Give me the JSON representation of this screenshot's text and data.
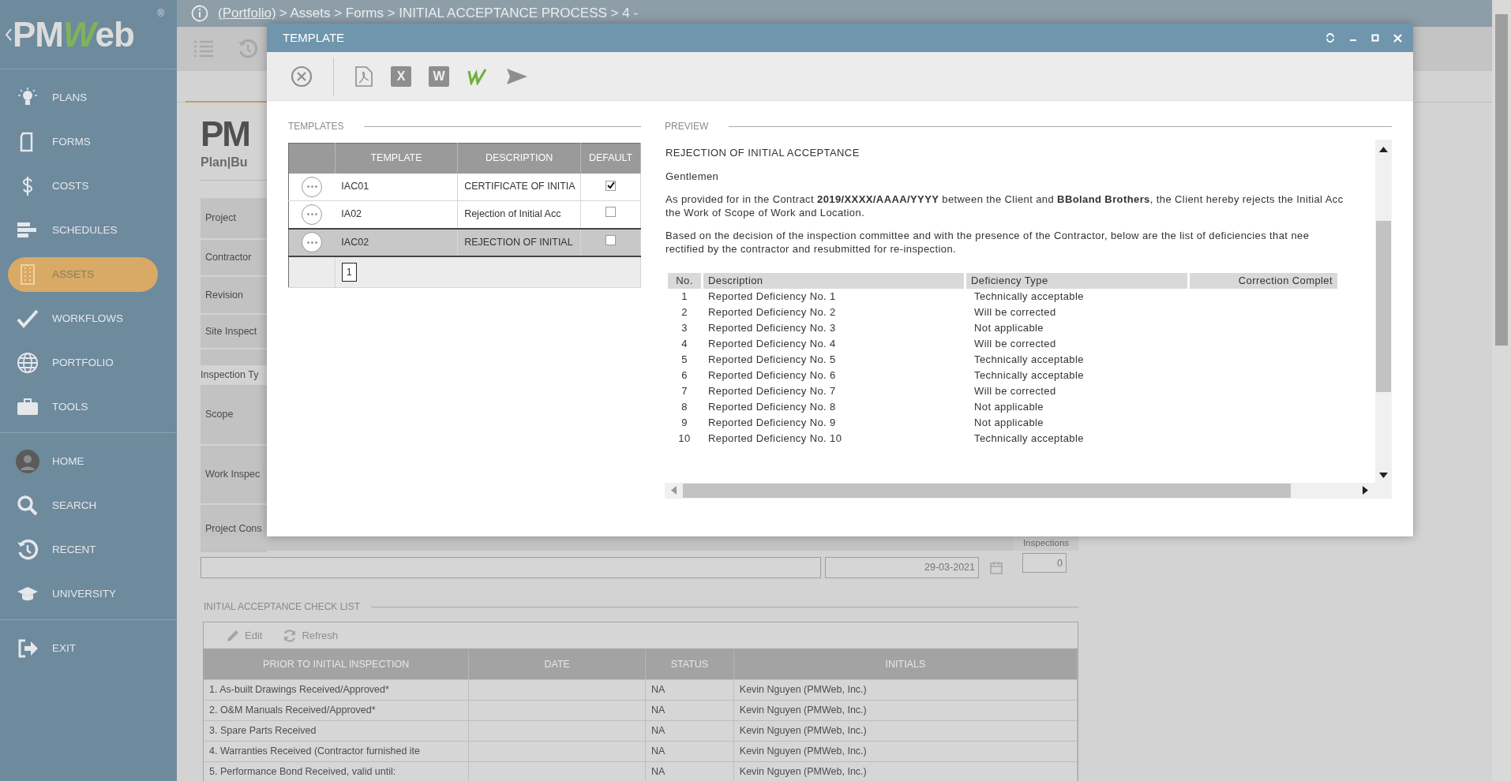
{
  "sidebar": {
    "logo": "PMWeb",
    "registered": "®",
    "sections": [
      {
        "items": [
          {
            "label": "PLANS",
            "selected": false
          },
          {
            "label": "FORMS",
            "selected": false
          },
          {
            "label": "COSTS",
            "selected": false
          },
          {
            "label": "SCHEDULES",
            "selected": false
          },
          {
            "label": "ASSETS",
            "selected": true
          },
          {
            "label": "WORKFLOWS",
            "selected": false
          },
          {
            "label": "PORTFOLIO",
            "selected": false
          },
          {
            "label": "TOOLS",
            "selected": false
          }
        ]
      },
      {
        "items": [
          {
            "label": "HOME",
            "selected": false
          },
          {
            "label": "SEARCH",
            "selected": false
          },
          {
            "label": "RECENT",
            "selected": false
          },
          {
            "label": "UNIVERSITY",
            "selected": false
          }
        ]
      },
      {
        "items": [
          {
            "label": "EXIT",
            "selected": false
          }
        ]
      }
    ]
  },
  "breadcrumb": {
    "link": "(Portfolio)",
    "path": "> Assets > Forms > INITIAL ACCEPTANCE PROCESS > 4 -"
  },
  "form": {
    "logo": "PM",
    "tagline": "Plan|Bu",
    "fields": [
      {
        "kind": "label",
        "label": "Project"
      },
      {
        "kind": "label",
        "label": "Contractor"
      },
      {
        "kind": "label",
        "label": "Revision"
      },
      {
        "kind": "label",
        "label": "Site Inspect"
      },
      {
        "kind": "spacer"
      },
      {
        "kind": "heading",
        "label": "Inspection Ty"
      },
      {
        "kind": "label",
        "label": "Scope"
      },
      {
        "kind": "label",
        "label": "Work Inspec"
      },
      {
        "kind": "label",
        "label": "Project Cons"
      }
    ],
    "inspections_label": "Inspections",
    "date": "29-03-2021",
    "count": "0"
  },
  "checklist": {
    "heading": "INITIAL ACCEPTANCE CHECK LIST",
    "tools": [
      {
        "kind": "edit",
        "label": "Edit"
      },
      {
        "kind": "refresh",
        "label": "Refresh"
      }
    ],
    "columns": [
      "PRIOR TO INITIAL INSPECTION",
      "DATE",
      "STATUS",
      "INITIALS"
    ],
    "rows": [
      {
        "item": "1. As-built Drawings Received/Approved*",
        "status": "NA",
        "initials": "Kevin Nguyen (PMWeb, Inc.)"
      },
      {
        "item": "2. O&M Manuals Received/Approved*",
        "status": "NA",
        "initials": "Kevin Nguyen (PMWeb, Inc.)"
      },
      {
        "item": "3. Spare Parts Received",
        "status": "NA",
        "initials": "Kevin Nguyen (PMWeb, Inc.)"
      },
      {
        "item": "4. Warranties Received (Contractor furnished ite",
        "status": "NA",
        "initials": "Kevin Nguyen (PMWeb, Inc.)"
      },
      {
        "item": "5. Performance Bond Received, valid until:",
        "status": "NA",
        "initials": "Kevin Nguyen (PMWeb, Inc.)"
      }
    ]
  },
  "modal": {
    "title": "TEMPLATE",
    "toolbar": [
      {
        "kind": "close"
      },
      {
        "kind": "pdf"
      },
      {
        "kind": "excel",
        "label": "X"
      },
      {
        "kind": "word",
        "label": "W"
      },
      {
        "kind": "zigzag"
      },
      {
        "kind": "send"
      }
    ],
    "templates": {
      "heading": "TEMPLATES",
      "columns": [
        "TEMPLATE",
        "DESCRIPTION",
        "DEFAULT"
      ],
      "rows": [
        {
          "template": "IAC01",
          "description": "CERTIFICATE OF INITIA",
          "default": true,
          "selected": false
        },
        {
          "template": "IA02",
          "description": "Rejection of Initial Acc",
          "default": false,
          "selected": false
        },
        {
          "template": "IAC02",
          "description": "REJECTION OF INITIAL",
          "default": false,
          "selected": true
        }
      ],
      "pages": [
        {
          "label": "1",
          "selected": true
        }
      ]
    },
    "preview": {
      "heading": "PREVIEW",
      "title": "REJECTION OF INITIAL ACCEPTANCE",
      "greeting": "Gentlemen",
      "paragraphs": [
        {
          "lines": [
            "As provided for in the Contract **2019/XXXX/AAAA/YYYY** between the Client and **BBoland Brothers**, the Client hereby rejects the Initial Acc",
            "the Work of Scope of Work and Location."
          ]
        },
        {
          "lines": [
            "Based on the decision of the inspection committee and with the presence of the Contractor, below are the list of deficiencies that nee",
            "rectified by the contractor and resubmitted for re-inspection."
          ]
        }
      ],
      "columns": [
        "No.",
        "Description",
        "Deficiency Type",
        "Correction Complet"
      ],
      "rows": [
        [
          "1",
          "Reported Deficiency No. 1",
          "Technically acceptable"
        ],
        [
          "2",
          "Reported Deficiency No. 2",
          "Will be corrected"
        ],
        [
          "3",
          "Reported Deficiency No. 3",
          "Not applicable"
        ],
        [
          "4",
          "Reported Deficiency No. 4",
          "Will be corrected"
        ],
        [
          "5",
          "Reported Deficiency No. 5",
          "Technically acceptable"
        ],
        [
          "6",
          "Reported Deficiency No. 6",
          "Technically acceptable"
        ],
        [
          "7",
          "Reported Deficiency No. 7",
          "Will be corrected"
        ],
        [
          "8",
          "Reported Deficiency No. 8",
          "Not applicable"
        ],
        [
          "9",
          "Reported Deficiency No. 9",
          "Not applicable"
        ],
        [
          "10",
          "Reported Deficiency No. 10",
          "Technically acceptable"
        ]
      ]
    }
  }
}
